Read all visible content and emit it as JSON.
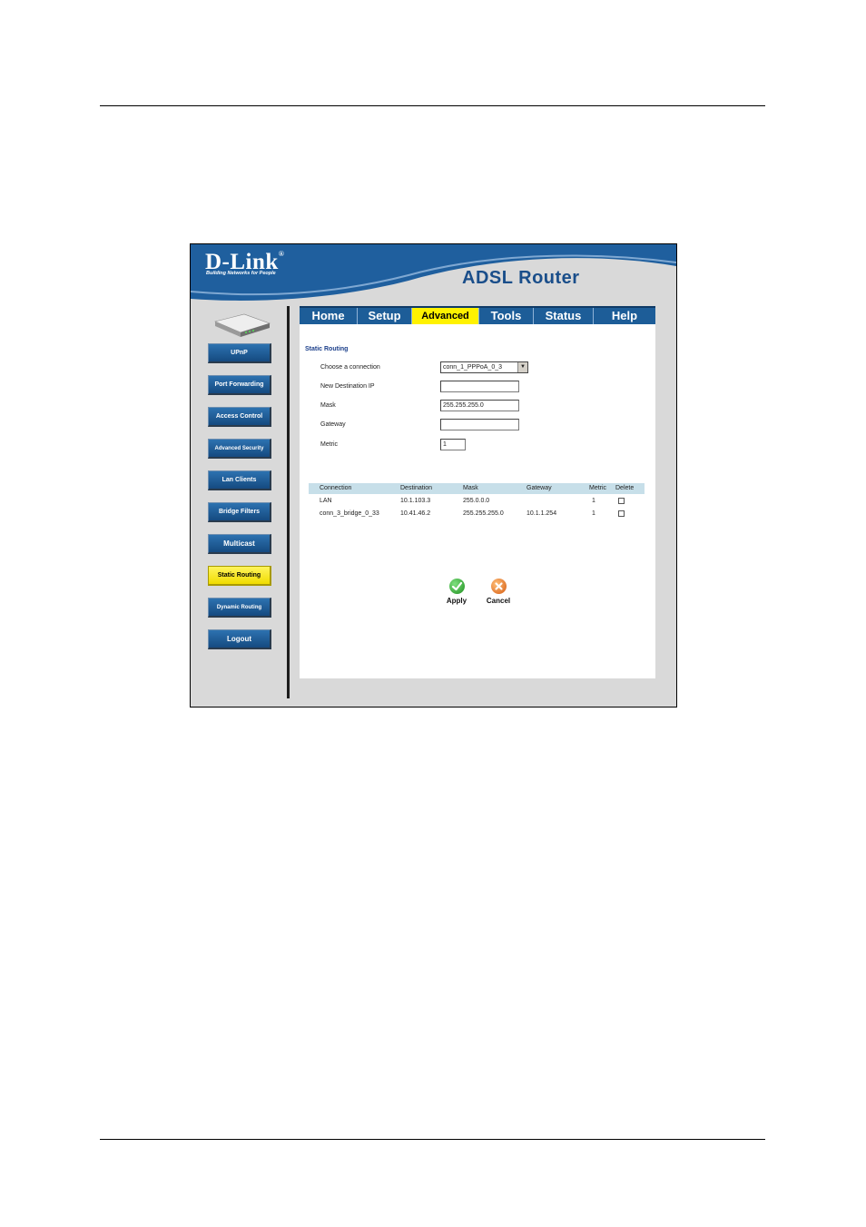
{
  "header": {
    "logo": "D-Link",
    "logo_mark": "®",
    "tagline": "Building Networks for People",
    "product": "ADSL Router"
  },
  "tabs": [
    {
      "label": "Home",
      "active": false
    },
    {
      "label": "Setup",
      "active": false
    },
    {
      "label": "Advanced",
      "active": true
    },
    {
      "label": "Tools",
      "active": false
    },
    {
      "label": "Status",
      "active": false
    },
    {
      "label": "Help",
      "active": false
    }
  ],
  "sidebar": {
    "items": [
      {
        "label": "UPnP",
        "active": false
      },
      {
        "label": "Port Forwarding",
        "active": false
      },
      {
        "label": "Access Control",
        "active": false
      },
      {
        "label": "Advanced Security",
        "active": false
      },
      {
        "label": "Lan Clients",
        "active": false
      },
      {
        "label": "Bridge Filters",
        "active": false
      },
      {
        "label": "Multicast",
        "active": false
      },
      {
        "label": "Static Routing",
        "active": true
      },
      {
        "label": "Dynamic Routing",
        "active": false
      },
      {
        "label": "Logout",
        "active": false
      }
    ]
  },
  "form": {
    "title": "Static Routing",
    "connection_label": "Choose a connection",
    "connection_value": "conn_1_PPPoA_0_3",
    "dest_label": "New Destination IP",
    "dest_value": "",
    "mask_label": "Mask",
    "mask_value": "255.255.255.0",
    "gateway_label": "Gateway",
    "gateway_value": "",
    "metric_label": "Metric",
    "metric_value": "1"
  },
  "table": {
    "headers": [
      "Connection",
      "Destination",
      "Mask",
      "Gateway",
      "Metric",
      "Delete"
    ],
    "rows": [
      {
        "connection": "LAN",
        "destination": "10.1.103.3",
        "mask": "255.0.0.0",
        "gateway": "",
        "metric": "1",
        "delete": false
      },
      {
        "connection": "conn_3_bridge_0_33",
        "destination": "10.41.46.2",
        "mask": "255.255.255.0",
        "gateway": "10.1.1.254",
        "metric": "1",
        "delete": false
      }
    ]
  },
  "actions": {
    "apply_label": "Apply",
    "cancel_label": "Cancel"
  },
  "colors": {
    "banner_blue": "#1f5f9e",
    "tab_active": "#fff200",
    "button_blue": "#1f5c98",
    "apply_green": "#2aa12a",
    "cancel_orange": "#e8731f"
  }
}
